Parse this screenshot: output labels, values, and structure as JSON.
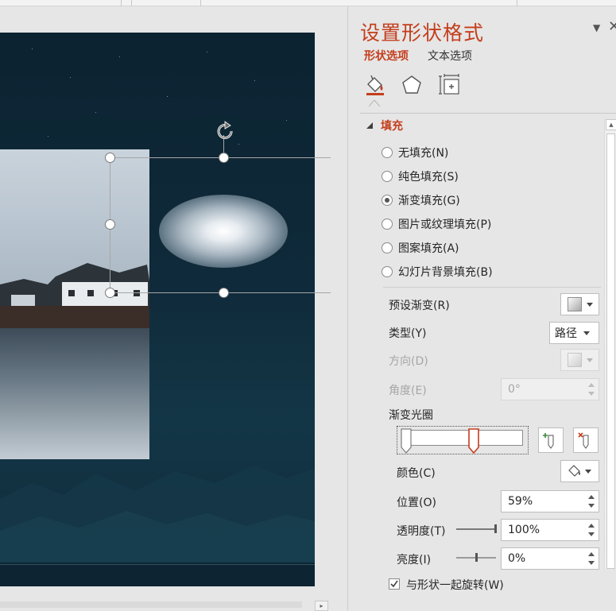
{
  "pane": {
    "title": "设置形状格式",
    "tabs": {
      "shape_options": "形状选项",
      "text_options": "文本选项"
    },
    "category_icons": [
      "fill-line-icon",
      "effects-pentagon-icon",
      "size-properties-icon"
    ]
  },
  "fill": {
    "section_title": "填充",
    "options": [
      {
        "label": "无填充(N)",
        "checked": false
      },
      {
        "label": "纯色填充(S)",
        "checked": false
      },
      {
        "label": "渐变填充(G)",
        "checked": true
      },
      {
        "label": "图片或纹理填充(P)",
        "checked": false
      },
      {
        "label": "图案填充(A)",
        "checked": false
      },
      {
        "label": "幻灯片背景填充(B)",
        "checked": false
      }
    ]
  },
  "gradient": {
    "preset_label": "预设渐变(R)",
    "type_label": "类型(Y)",
    "type_value": "路径",
    "direction_label": "方向(D)",
    "angle_label": "角度(E)",
    "angle_value": "0°",
    "stops_label": "渐变光圈",
    "stop_positions_percent": [
      0,
      59
    ],
    "selected_stop": 1,
    "color_label": "颜色(C)",
    "position_label": "位置(O)",
    "position_value": "59%",
    "transparency_label": "透明度(T)",
    "transparency_value": "100%",
    "transparency_fraction": 1.0,
    "brightness_label": "亮度(I)",
    "brightness_value": "0%",
    "brightness_fraction": 0.5,
    "rotate_with_shape_label": "与形状一起旋转(W)",
    "rotate_with_shape_checked": true
  },
  "colors": {
    "accent": "#c43e1c",
    "slide_background": "#0f2a3a"
  }
}
